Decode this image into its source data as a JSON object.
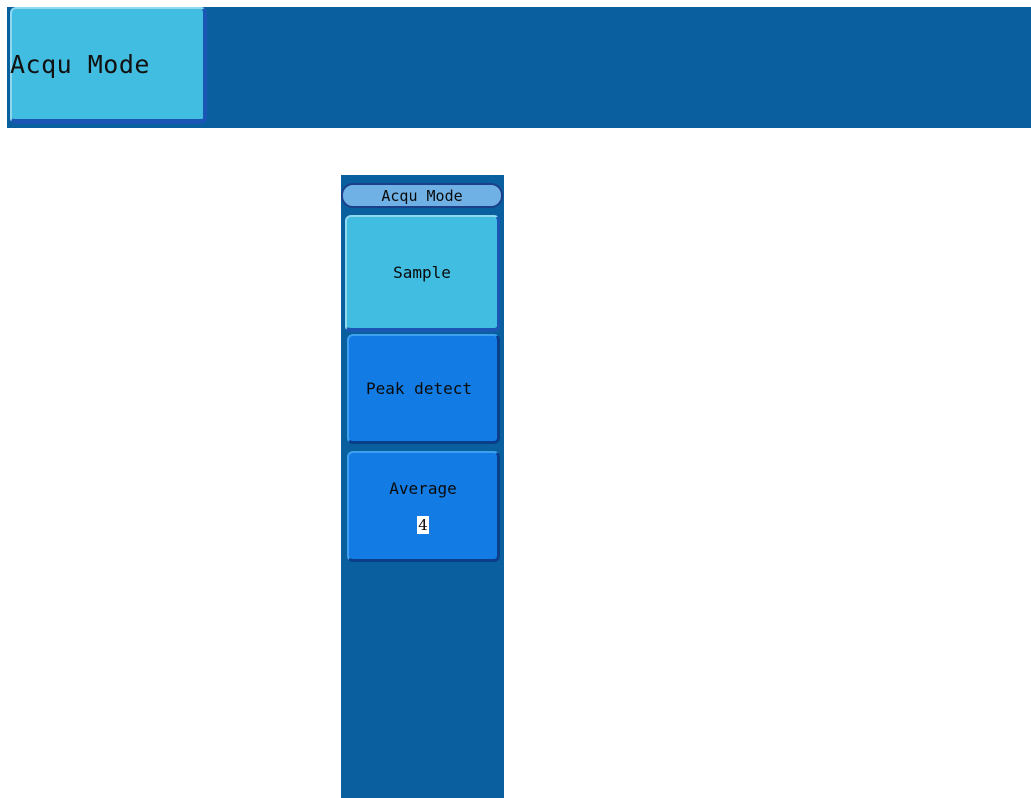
{
  "top_bar": {
    "acqu_mode_button_label": "Acqu Mode"
  },
  "menu": {
    "title": "Acqu Mode",
    "items": [
      {
        "label": "Sample",
        "selected": true
      },
      {
        "label": "Peak detect",
        "selected": false
      },
      {
        "label": "Average",
        "value": "4",
        "selected": false
      }
    ]
  },
  "colors": {
    "panel_bg": "#0a609f",
    "selected_button": "#41bde2",
    "unselected_button": "#127ce4",
    "title_bg": "#6fb1e5"
  }
}
